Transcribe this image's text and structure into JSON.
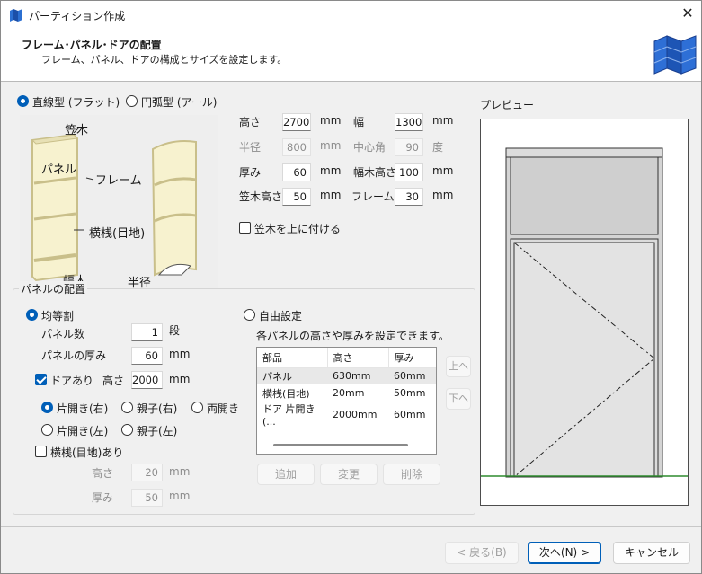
{
  "window": {
    "title": "パーティション作成",
    "close_icon": "close-icon"
  },
  "header": {
    "title": "フレーム･パネル･ドアの配置",
    "subtitle": "フレーム、パネル、ドアの構成とサイズを設定します。"
  },
  "shape": {
    "linear_label": "直線型 (フラット)",
    "arc_label": "円弧型 (アール)",
    "selected": "linear"
  },
  "illustration": {
    "kasagi": "笠木",
    "panel": "パネル",
    "frame": "フレーム",
    "yokosan": "横桟(目地)",
    "habaki": "幅木",
    "radius": "半径"
  },
  "dims": {
    "height_label": "高さ",
    "height_value": "2700",
    "height_unit": "mm",
    "width_label": "幅",
    "width_value": "1300",
    "width_unit": "mm",
    "radius_label": "半径",
    "radius_value": "800",
    "radius_unit": "mm",
    "angle_label": "中心角",
    "angle_value": "90",
    "angle_unit": "度",
    "thickness_label": "厚み",
    "thickness_value": "60",
    "thickness_unit": "mm",
    "habaki_label": "幅木高さ",
    "habaki_value": "100",
    "habaki_unit": "mm",
    "kasagi_label": "笠木高さ",
    "kasagi_value": "50",
    "kasagi_unit": "mm",
    "frame_label": "フレーム幅",
    "frame_value": "30",
    "frame_unit": "mm",
    "kasagi_top_label": "笠木を上に付ける"
  },
  "panel": {
    "group_label": "パネルの配置",
    "equal_label": "均等割",
    "count_label": "パネル数",
    "count_value": "1",
    "count_unit": "段",
    "thick_label": "パネルの厚み",
    "thick_value": "60",
    "thick_unit": "mm",
    "door_label": "ドアあり",
    "door_height_label": "高さ",
    "door_height_value": "2000",
    "door_height_unit": "mm",
    "door_types": [
      "片開き(右)",
      "親子(右)",
      "両開き",
      "片開き(左)",
      "親子(左)"
    ],
    "yokosan_label": "横桟(目地)あり",
    "y_height_label": "高さ",
    "y_height_value": "20",
    "y_height_unit": "mm",
    "y_thick_label": "厚み",
    "y_thick_value": "50",
    "y_thick_unit": "mm",
    "free_label": "自由設定",
    "free_desc": "各パネルの高さや厚みを設定できます。",
    "list_headers": [
      "部品",
      "高さ",
      "厚み"
    ],
    "list_rows": [
      [
        "パネル",
        "630mm",
        "60mm"
      ],
      [
        "横桟(目地)",
        "20mm",
        "50mm"
      ],
      [
        "ドア 片開き(...",
        "2000mm",
        "60mm"
      ]
    ],
    "up_label": "上へ",
    "down_label": "下へ",
    "add_label": "追加",
    "edit_label": "変更",
    "delete_label": "削除"
  },
  "preview": {
    "label": "プレビュー"
  },
  "footer": {
    "back_label": "< 戻る(B)",
    "next_label": "次へ(N) >",
    "cancel_label": "キャンセル"
  },
  "colors": {
    "accent": "#005fb8",
    "ground": "#2e8b2e"
  }
}
